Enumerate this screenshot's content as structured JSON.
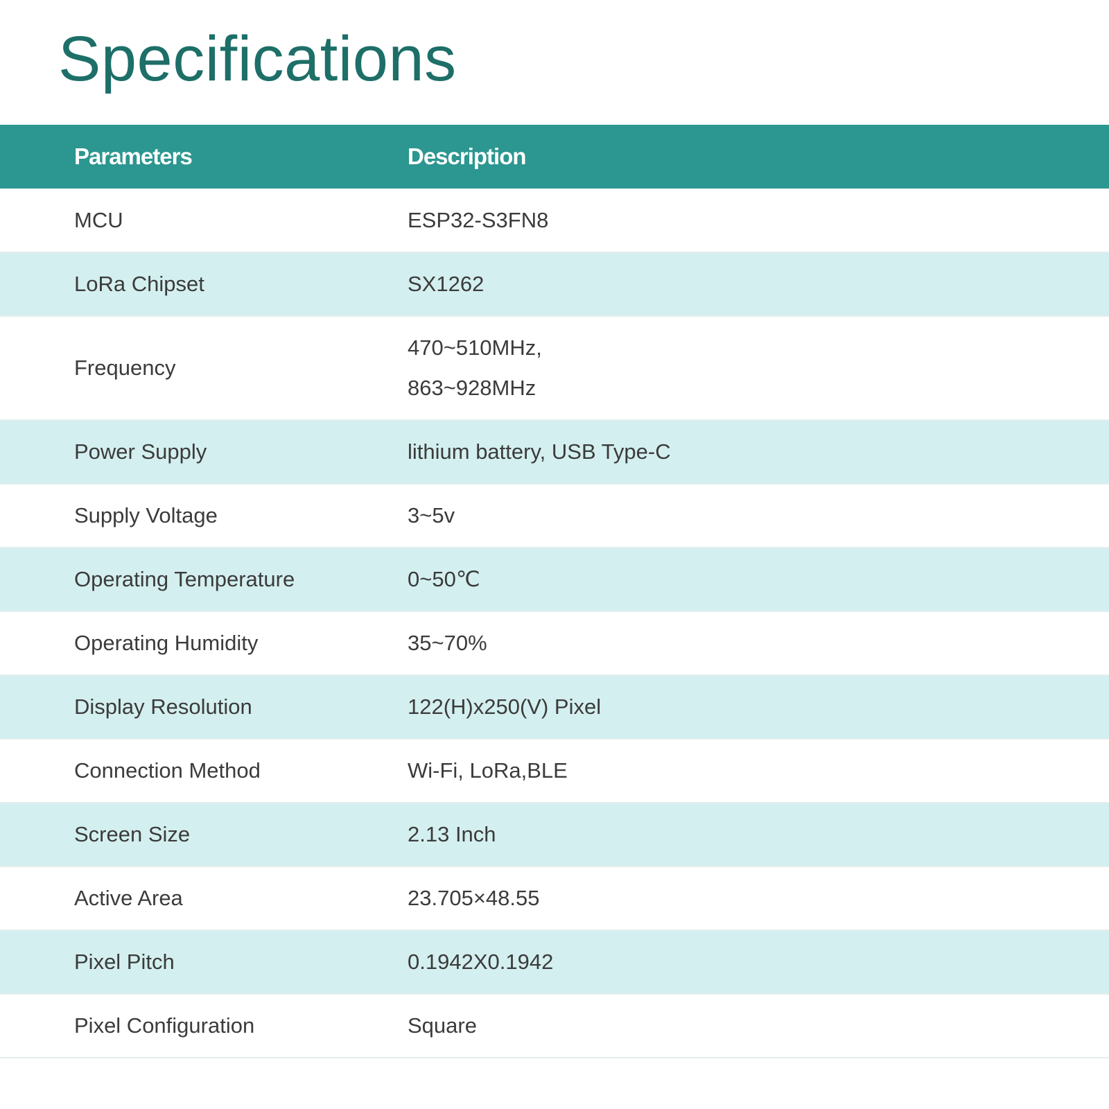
{
  "page": {
    "title": "Specifications"
  },
  "table": {
    "headers": {
      "parameters": "Parameters",
      "description": "Description"
    },
    "rows": [
      {
        "param": "MCU",
        "values": [
          "ESP32-S3FN8"
        ]
      },
      {
        "param": "LoRa Chipset",
        "values": [
          "SX1262"
        ]
      },
      {
        "param": "Frequency",
        "values": [
          "470~510MHz,",
          "863~928MHz"
        ]
      },
      {
        "param": "Power Supply",
        "values": [
          "lithium battery, USB Type-C"
        ]
      },
      {
        "param": "Supply Voltage",
        "values": [
          "3~5v"
        ]
      },
      {
        "param": "Operating Temperature",
        "values": [
          "0~50℃"
        ]
      },
      {
        "param": "Operating Humidity",
        "values": [
          "35~70%"
        ]
      },
      {
        "param": "Display Resolution",
        "values": [
          "122(H)x250(V) Pixel"
        ]
      },
      {
        "param": "Connection Method",
        "values": [
          "Wi-Fi, LoRa,BLE"
        ]
      },
      {
        "param": "Screen Size",
        "values": [
          "2.13 Inch"
        ]
      },
      {
        "param": "Active Area",
        "values": [
          "23.705×48.55"
        ]
      },
      {
        "param": "Pixel Pitch",
        "values": [
          "0.1942X0.1942"
        ]
      },
      {
        "param": "Pixel Configuration",
        "values": [
          "Square"
        ]
      }
    ]
  },
  "colors": {
    "title": "#1d6f68",
    "header_bg": "#2c9690",
    "stripe": "#d4efef"
  }
}
